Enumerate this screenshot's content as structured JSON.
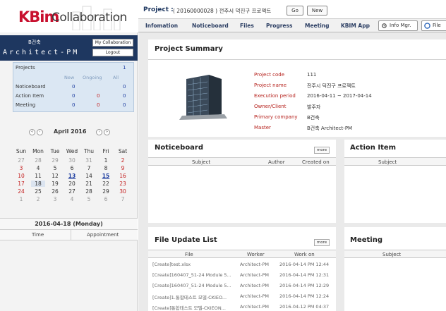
{
  "logo": {
    "brand": "KBim",
    "product": "Collaboration"
  },
  "user": {
    "company": "B건축",
    "name": "Architect-PM",
    "my_collab_label": "My Collaboration",
    "logout_label": "Logout"
  },
  "summary": {
    "projects_label": "Projects",
    "projects_count": "1",
    "headers": [
      "New",
      "Ongoing",
      "All"
    ],
    "rows": [
      {
        "label": "Noticeboard",
        "new": "0",
        "ongoing": "",
        "all": "0"
      },
      {
        "label": "Action Item",
        "new": "0",
        "ongoing": "0",
        "all": "0"
      },
      {
        "label": "Meeting",
        "new": "0",
        "ongoing": "0",
        "all": "0"
      }
    ]
  },
  "calendar": {
    "month": "April 2016",
    "weekdays": [
      "Sun",
      "Mon",
      "Tue",
      "Wed",
      "Thu",
      "Fri",
      "Sat"
    ],
    "weeks": [
      [
        "27",
        "28",
        "29",
        "30",
        "31",
        "1",
        "2"
      ],
      [
        "3",
        "4",
        "5",
        "6",
        "7",
        "8",
        "9"
      ],
      [
        "10",
        "11",
        "12",
        "13",
        "14",
        "15",
        "16"
      ],
      [
        "17",
        "18",
        "19",
        "20",
        "21",
        "22",
        "23"
      ],
      [
        "24",
        "25",
        "26",
        "27",
        "28",
        "29",
        "30"
      ],
      [
        "1",
        "2",
        "3",
        "4",
        "5",
        "6",
        "7"
      ]
    ],
    "selected_date": "2016-04-18 (Monday)",
    "col_time": "Time",
    "col_appointment": "Appointment"
  },
  "project_bar": {
    "label": "Project :",
    "value": "( 20160000028 ) 전주시 덕진구 프로젝트",
    "go_label": "Go",
    "new_label": "New"
  },
  "menu": {
    "items": [
      "Infomation",
      "Noticeboard",
      "Files",
      "Progress",
      "Meeting",
      "KBIM App"
    ],
    "info_mgr_label": "Info Mgr.",
    "file_label": "File"
  },
  "project_summary": {
    "title": "Project Summary",
    "fields": [
      {
        "key": "Project code",
        "value": "111"
      },
      {
        "key": "Project name",
        "value": "전주시 덕진구 프로젝트"
      },
      {
        "key": "Execution period",
        "value": "2016-04-11 ~ 2017-04-14"
      },
      {
        "key": "Owner/Client",
        "value": "발주자"
      },
      {
        "key": "Primary company",
        "value": "B건축"
      },
      {
        "key": "Master",
        "value": "B건축 Architect-PM"
      }
    ]
  },
  "noticeboard": {
    "title": "Noticeboard",
    "more": "more",
    "cols": [
      "Subject",
      "Author",
      "Created on"
    ]
  },
  "action_item": {
    "title": "Action Item",
    "cols": [
      "Subject"
    ]
  },
  "file_update": {
    "title": "File Update List",
    "more": "more",
    "cols": [
      "File",
      "Worker",
      "Work on"
    ],
    "rows": [
      {
        "file": "[Create]test.xlsx",
        "worker": "Architect-PM",
        "on": "2016-04-14 PM 12:44"
      },
      {
        "file": "[Create]160407_51-24 Module 5...",
        "worker": "Architect-PM",
        "on": "2016-04-14 PM 12:31"
      },
      {
        "file": "[Create]160407_51-24 Module 5...",
        "worker": "Architect-PM",
        "on": "2016-04-14 PM 12:29"
      },
      {
        "file": "[Create]1.통합테스트 모델-CKIEO...",
        "worker": "Architect-PM",
        "on": "2016-04-14 PM 12:24"
      },
      {
        "file": "[Create]통합테스트 모델-CKIEON...",
        "worker": "Architect-PM",
        "on": "2016-04-12 PM 04:37"
      }
    ]
  },
  "meeting": {
    "title": "Meeting",
    "cols": [
      "Subject"
    ]
  },
  "colors": {
    "navy": "#1e3760",
    "brand_red": "#c8102e",
    "field_red": "#b6221d",
    "summary_bg": "#dbe7f3"
  }
}
